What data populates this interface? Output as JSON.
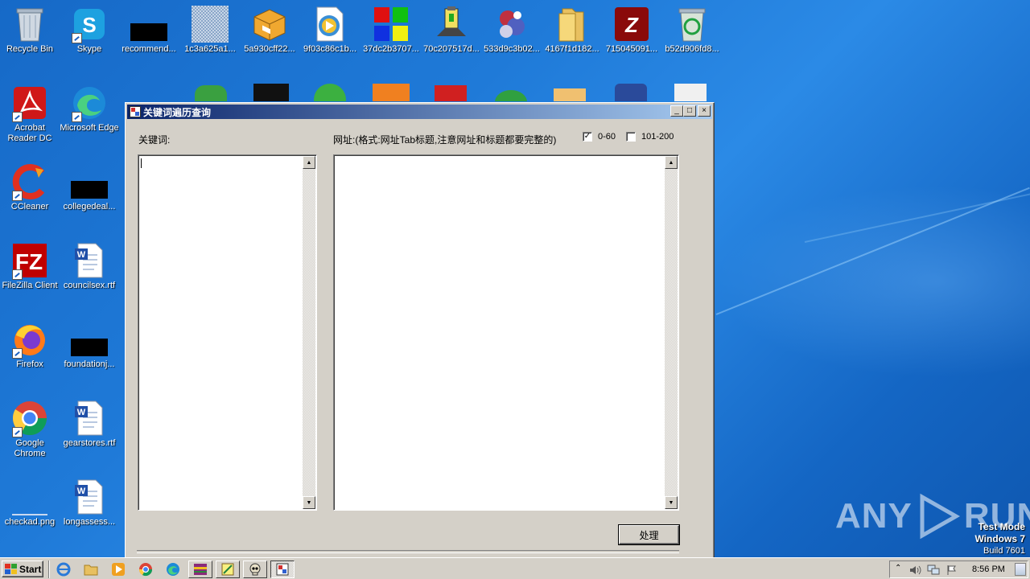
{
  "desktop": {
    "icons": [
      {
        "label": "Recycle Bin",
        "icon": "recycle-bin-icon"
      },
      {
        "label": "Skype",
        "icon": "skype-icon"
      },
      {
        "label": "recommend...",
        "icon": "black-thumbnail-icon"
      },
      {
        "label": "1c3a625a1...",
        "icon": "noise-image-icon"
      },
      {
        "label": "5a930cff22...",
        "icon": "package-icon"
      },
      {
        "label": "9f03c86c1b...",
        "icon": "media-player-file-icon"
      },
      {
        "label": "37dc2b3707...",
        "icon": "color-blocks-icon"
      },
      {
        "label": "70c207517d...",
        "icon": "usb-device-icon"
      },
      {
        "label": "533d9c3b02...",
        "icon": "jumble-icon"
      },
      {
        "label": "4167f1d182...",
        "icon": "folder-icon"
      },
      {
        "label": "715045091...",
        "icon": "red-logo-icon"
      },
      {
        "label": "b52d906fd8...",
        "icon": "recycle-full-icon"
      },
      {
        "label": "Acrobat Reader DC",
        "icon": "acrobat-icon"
      },
      {
        "label": "Microsoft Edge",
        "icon": "edge-icon"
      },
      {
        "label": "CCleaner",
        "icon": "ccleaner-icon"
      },
      {
        "label": "collegedeal...",
        "icon": "black-thumbnail-icon"
      },
      {
        "label": "FileZilla Client",
        "icon": "filezilla-icon"
      },
      {
        "label": "councilsex.rtf",
        "icon": "word-document-icon"
      },
      {
        "label": "Firefox",
        "icon": "firefox-icon"
      },
      {
        "label": "foundationj...",
        "icon": "black-thumbnail-icon"
      },
      {
        "label": "Google Chrome",
        "icon": "chrome-icon"
      },
      {
        "label": "gearstores.rtf",
        "icon": "word-document-icon"
      },
      {
        "label": "checkad.png",
        "icon": "image-thumbnail-icon"
      },
      {
        "label": "longassess...",
        "icon": "word-document-icon"
      }
    ]
  },
  "window": {
    "title": "关键词遍历查询",
    "keyword_label": "关键词:",
    "url_label": "网址:(格式:网址Tab标题,注意网址和标题都要完整的)",
    "check_0_60": {
      "label": "0-60",
      "checked": true
    },
    "check_101_200": {
      "label": "101-200",
      "checked": false
    },
    "keyword_text": "",
    "url_text": "",
    "process_button": "处理",
    "minimize": "_",
    "maximize": "□",
    "close": "×"
  },
  "taskbar": {
    "start_label": "Start",
    "clock": "8:56 PM",
    "pinned": [
      "ie-icon",
      "explorer-icon",
      "media-player-icon",
      "chrome-icon",
      "edge-icon",
      "winrar-icon",
      "notepad-icon",
      "skull-icon",
      "app-window-icon"
    ]
  },
  "watermark": {
    "text_left": "ANY",
    "text_right": "RUN",
    "test_mode": "Test Mode",
    "os": "Windows 7",
    "build": "Build 7601"
  },
  "colors": {
    "desktop": "#1f7ad8",
    "title_active_start": "#0a246a",
    "title_active_end": "#a6caf0",
    "window_face": "#d4d0c8"
  }
}
